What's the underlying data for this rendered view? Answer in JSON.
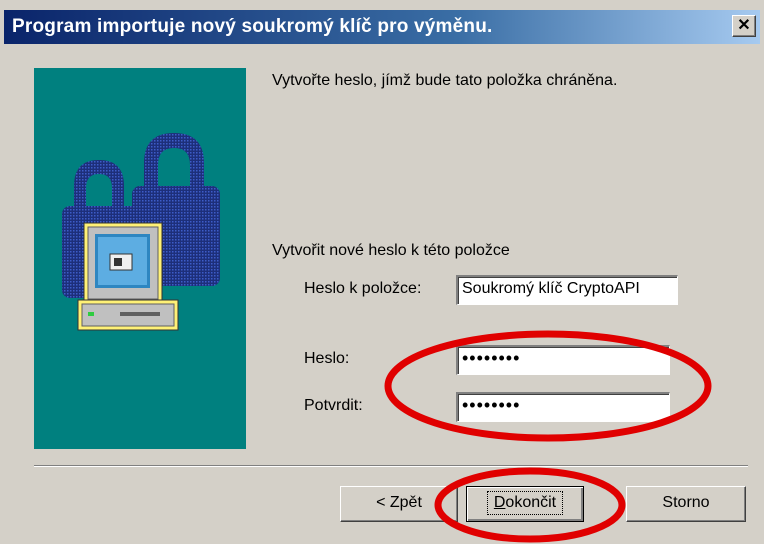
{
  "window": {
    "title": "Program importuje nový soukromý klíč pro výměnu.",
    "close_glyph": "✕"
  },
  "content": {
    "intro": "Vytvořte heslo, jímž bude tato položka chráněna.",
    "section_label": "Vytvořit nové heslo k této položce",
    "item_label": "Heslo k položce:",
    "item_value": "Soukromý klíč CryptoAPI",
    "password_label": "Heslo:",
    "password_value": "••••••••",
    "confirm_label": "Potvrdit:",
    "confirm_value": "••••••••"
  },
  "buttons": {
    "back": "< Zpět",
    "finish_mnemonic": "D",
    "finish_rest": "okončit",
    "cancel": "Storno"
  },
  "icons": {
    "side_panel": "computer-with-padlocks-icon",
    "close": "close-icon"
  },
  "colors": {
    "titlebar_start": "#0a246a",
    "titlebar_end": "#a6caf0",
    "side_panel": "#00807f",
    "annotation": "#e00000"
  }
}
